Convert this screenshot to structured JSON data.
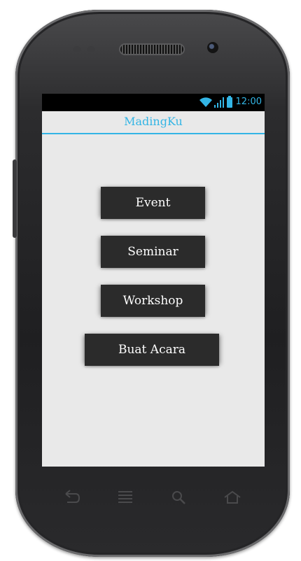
{
  "status_bar": {
    "time": "12:00",
    "icons": [
      "wifi-icon",
      "signal-icon",
      "battery-icon"
    ]
  },
  "app": {
    "title": "MadingKu"
  },
  "buttons": [
    {
      "label": "Event"
    },
    {
      "label": "Seminar"
    },
    {
      "label": "Workshop"
    },
    {
      "label": "Buat Acara"
    }
  ],
  "nav_bar": {
    "icons": [
      "back-icon",
      "menu-icon",
      "search-icon",
      "home-icon"
    ]
  },
  "colors": {
    "accent": "#33b5e5",
    "button_bg": "#2b2b2b",
    "screen_bg": "#e9e9e9"
  }
}
